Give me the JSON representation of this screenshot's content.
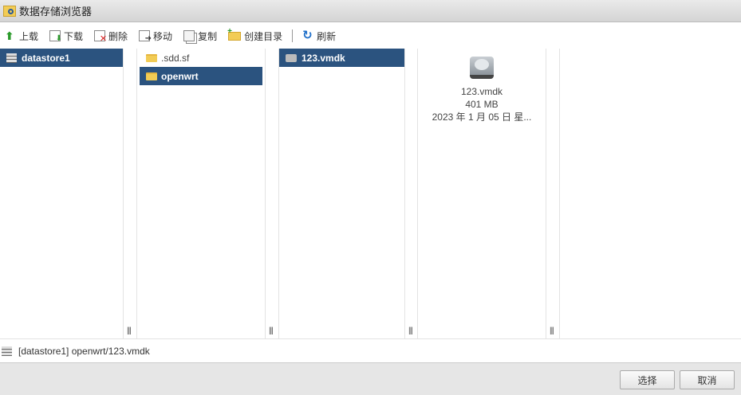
{
  "title": "数据存储浏览器",
  "toolbar": {
    "upload": "上载",
    "download": "下载",
    "delete": "删除",
    "move": "移动",
    "copy": "复制",
    "mkdir": "创建目录",
    "refresh": "刷新"
  },
  "columns": {
    "datastores": [
      "datastore1"
    ],
    "folders": [
      ".sdd.sf",
      "openwrt"
    ],
    "files": [
      "123.vmdk"
    ]
  },
  "preview": {
    "name": "123.vmdk",
    "size": "401 MB",
    "date": "2023 年 1 月 05 日 星..."
  },
  "status": {
    "path": "[datastore1] openwrt/123.vmdk"
  },
  "buttons": {
    "select": "选择",
    "cancel": "取消"
  },
  "grip": "|||"
}
